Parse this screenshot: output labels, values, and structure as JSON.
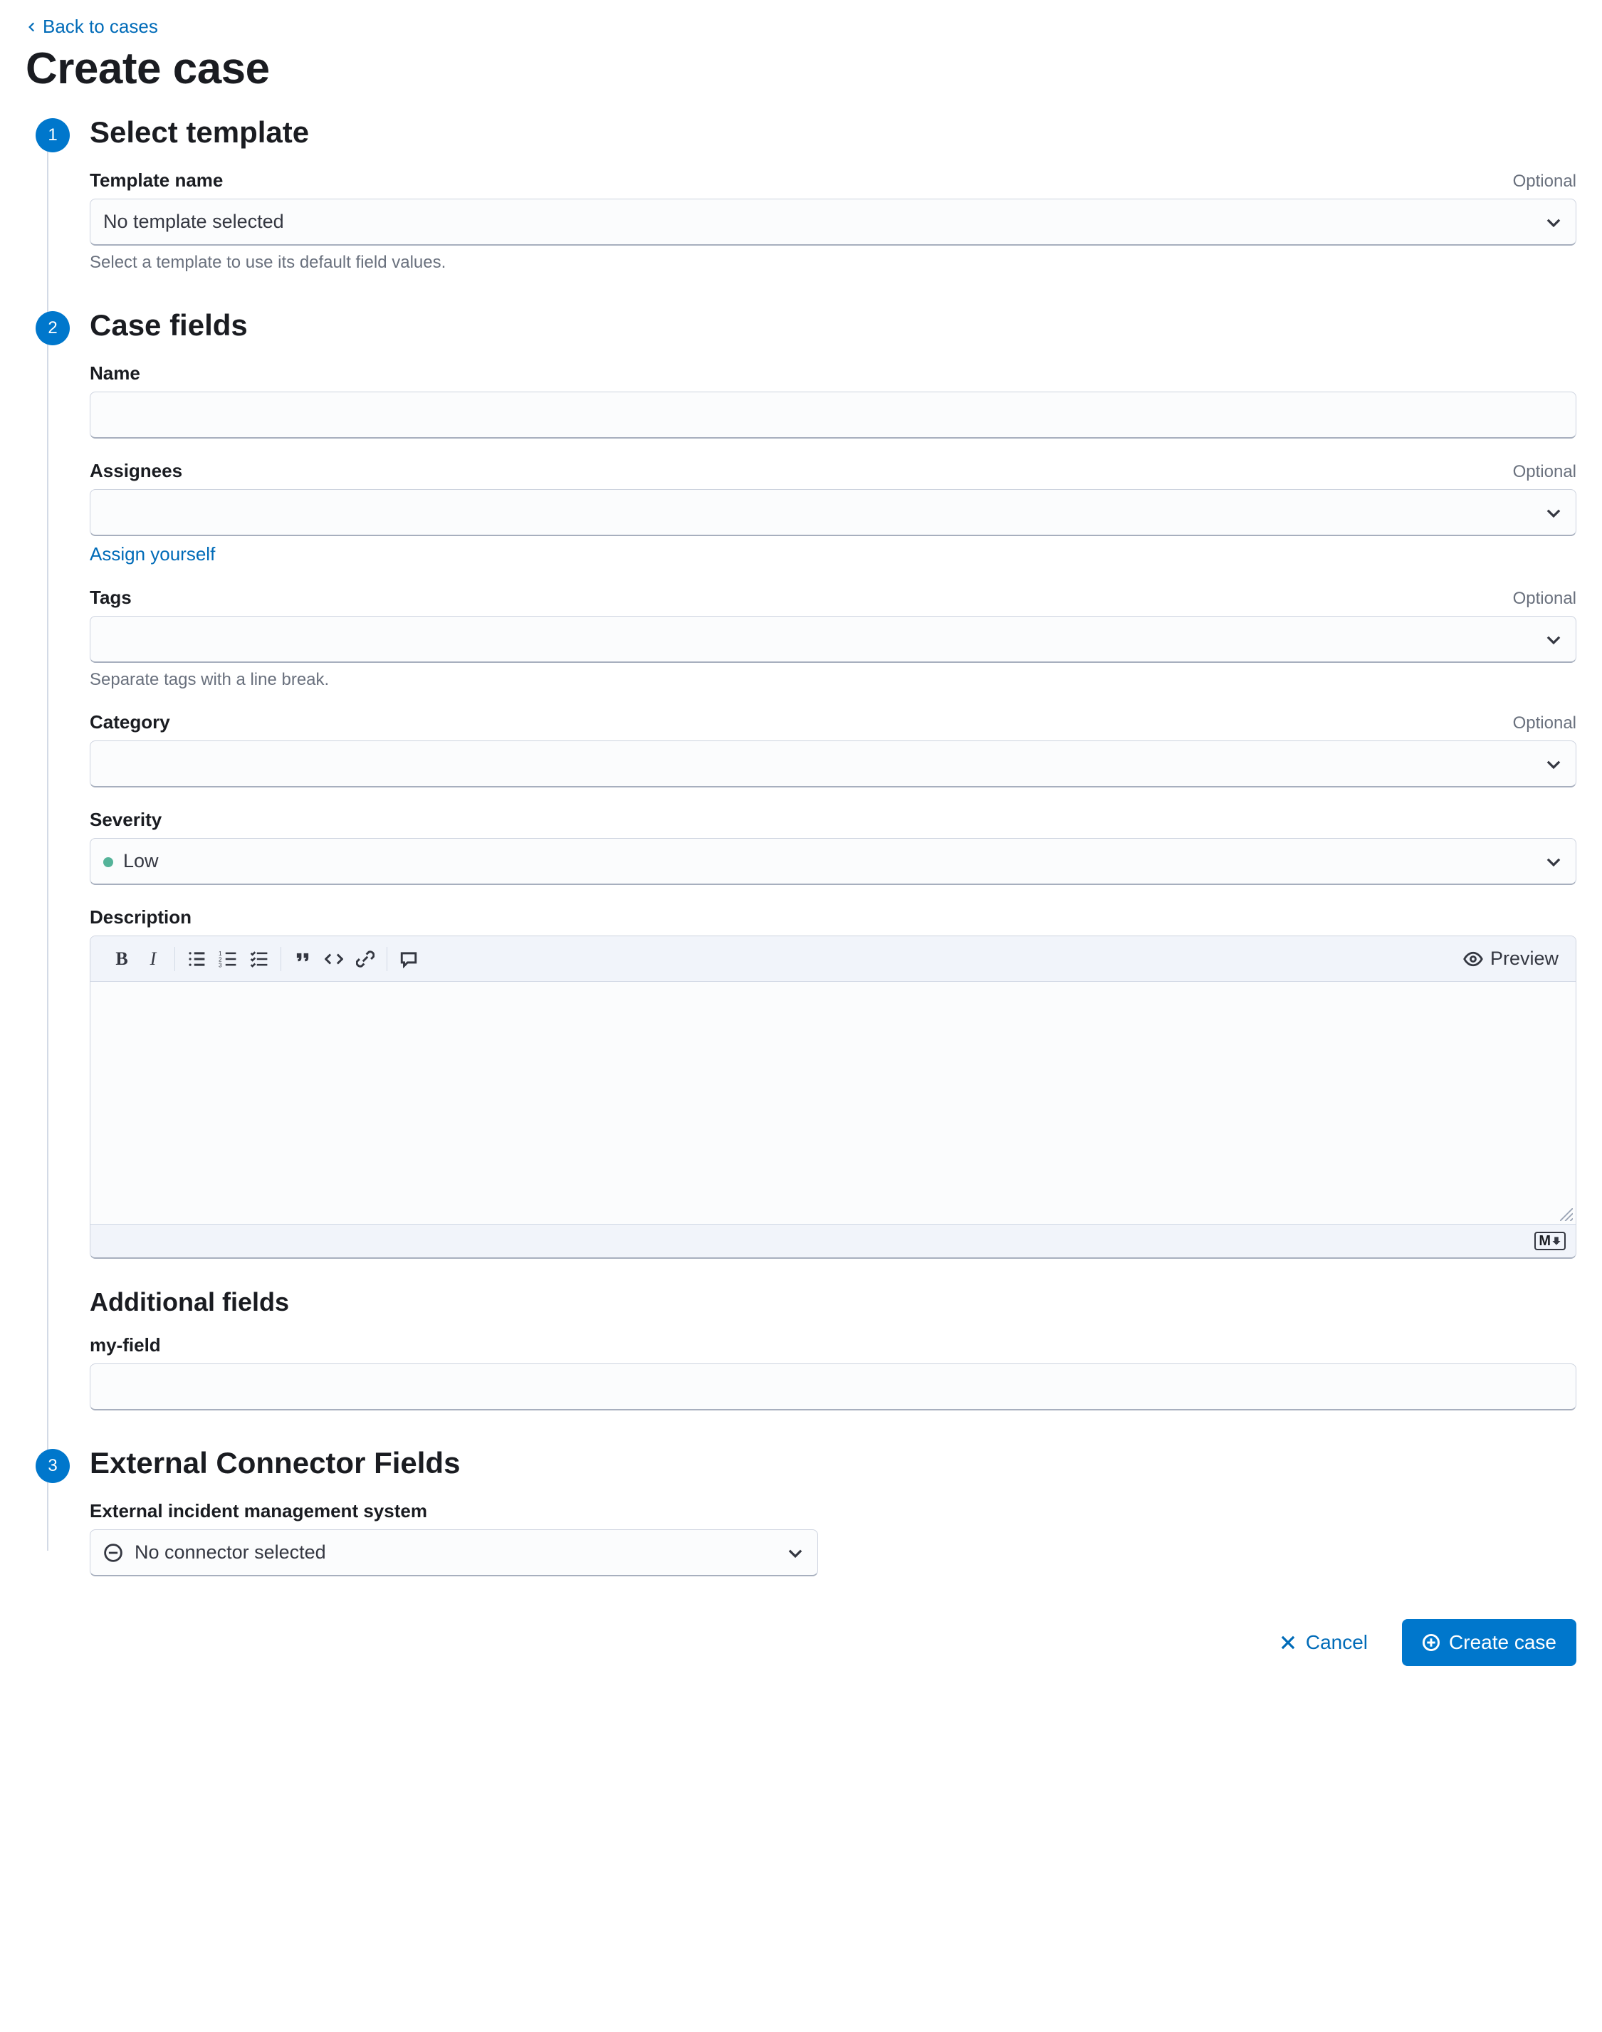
{
  "nav": {
    "back_label": "Back to cases"
  },
  "page_title": "Create case",
  "step1": {
    "title": "Select template",
    "template_name_label": "Template name",
    "template_name_optional": "Optional",
    "template_name_value": "No template selected",
    "template_name_help": "Select a template to use its default field values."
  },
  "step2": {
    "title": "Case fields",
    "name_label": "Name",
    "name_value": "",
    "assignees_label": "Assignees",
    "assignees_optional": "Optional",
    "assignees_value": "",
    "assign_yourself_link": "Assign yourself",
    "tags_label": "Tags",
    "tags_optional": "Optional",
    "tags_value": "",
    "tags_help": "Separate tags with a line break.",
    "category_label": "Category",
    "category_optional": "Optional",
    "category_value": "",
    "severity_label": "Severity",
    "severity_value": "Low",
    "description_label": "Description",
    "preview_label": "Preview",
    "markdown_badge": "M",
    "additional_title": "Additional fields",
    "custom_field_label": "my-field",
    "custom_field_value": ""
  },
  "step3": {
    "title": "External Connector Fields",
    "connector_label": "External incident management system",
    "connector_value": "No connector selected"
  },
  "footer": {
    "cancel_label": "Cancel",
    "submit_label": "Create case"
  }
}
